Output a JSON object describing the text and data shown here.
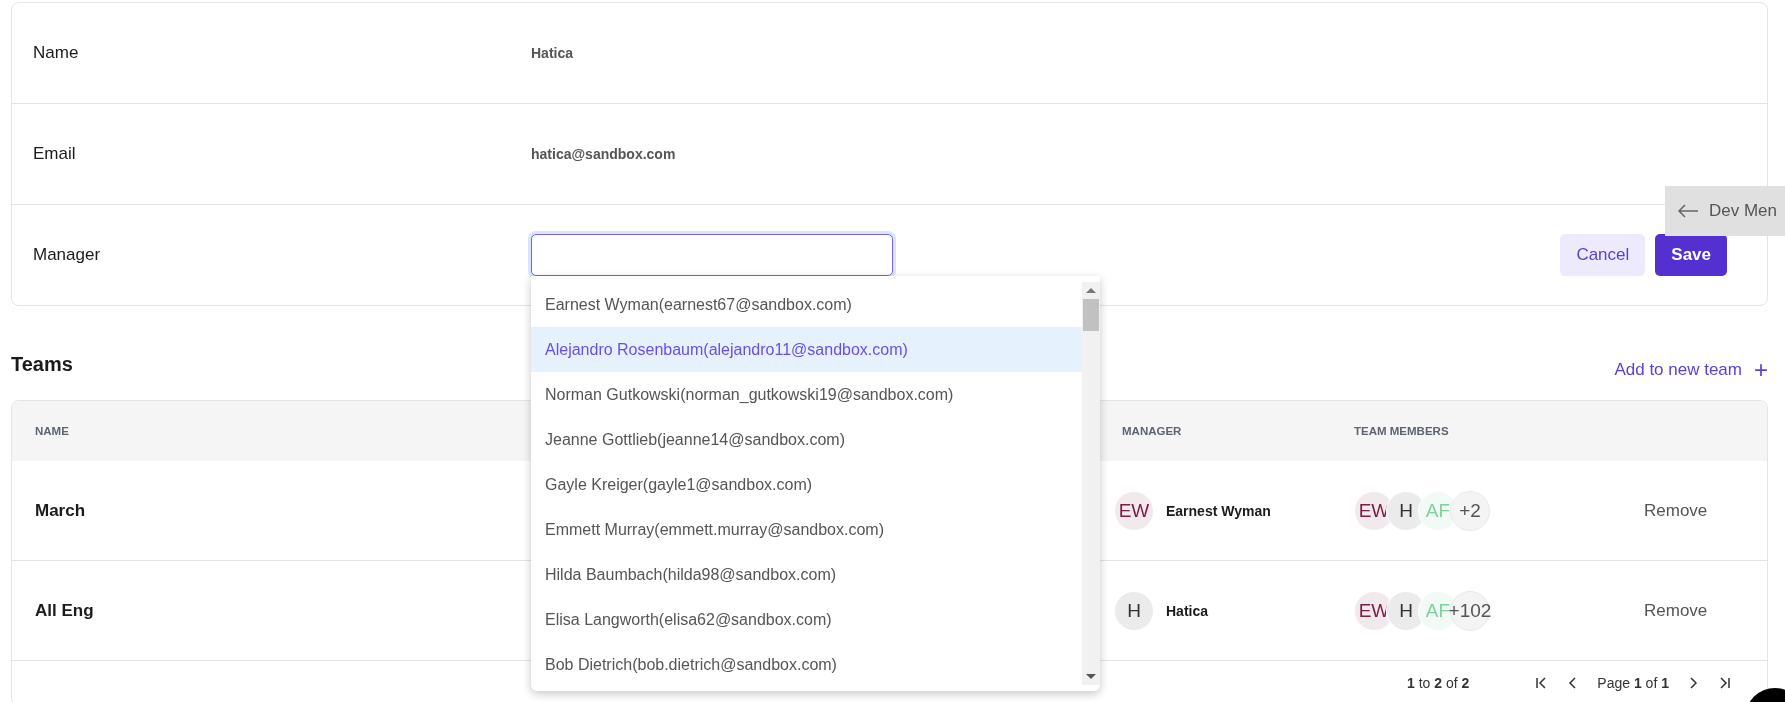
{
  "profile": {
    "fields": [
      {
        "label": "Name",
        "value": "Hatica"
      },
      {
        "label": "Email",
        "value": "hatica@sandbox.com"
      }
    ],
    "manager": {
      "label": "Manager",
      "options": [
        {
          "label": "Earnest Wyman(earnest67@sandbox.com)",
          "selected": false
        },
        {
          "label": "Alejandro Rosenbaum(alejandro11@sandbox.com)",
          "selected": true
        },
        {
          "label": "Norman Gutkowski(norman_gutkowski19@sandbox.com)",
          "selected": false
        },
        {
          "label": "Jeanne Gottlieb(jeanne14@sandbox.com)",
          "selected": false
        },
        {
          "label": "Gayle Kreiger(gayle1@sandbox.com)",
          "selected": false
        },
        {
          "label": "Emmett Murray(emmett.murray@sandbox.com)",
          "selected": false
        },
        {
          "label": "Hilda Baumbach(hilda98@sandbox.com)",
          "selected": false
        },
        {
          "label": "Elisa Langworth(elisa62@sandbox.com)",
          "selected": false
        },
        {
          "label": "Bob Dietrich(bob.dietrich@sandbox.com)",
          "selected": false
        }
      ]
    },
    "buttons": [
      "Cancel",
      "Save"
    ]
  },
  "dev_menu": {
    "label": "Dev Men"
  },
  "teams": {
    "title": "Teams",
    "add_link": "Add to new team",
    "add_icon": "+",
    "table": {
      "columns": [
        "NAME",
        "MANAGER",
        "TEAM MEMBERS"
      ],
      "rows": [
        {
          "name": "March",
          "manager": {
            "initials": "EW",
            "name": "Earnest Wyman",
            "color": "#7a2048"
          },
          "members": [
            {
              "initials": "EW",
              "color": "#7a2048"
            },
            {
              "initials": "H",
              "color": "#333333"
            },
            {
              "initials": "AF",
              "color": "#7ed19a"
            }
          ],
          "more": "+2",
          "action": "Remove"
        },
        {
          "name": "All Eng",
          "manager": {
            "initials": "H",
            "name": "Hatica",
            "color": "#333333"
          },
          "members": [
            {
              "initials": "EW",
              "color": "#7a2048"
            },
            {
              "initials": "H",
              "color": "#333333"
            },
            {
              "initials": "AF",
              "color": "#7ed19a"
            }
          ],
          "more": "+102",
          "action": "Remove"
        }
      ]
    },
    "pagination": {
      "summary": "**1** to **2** of **2**",
      "page": "Page **1** of **1**"
    }
  }
}
